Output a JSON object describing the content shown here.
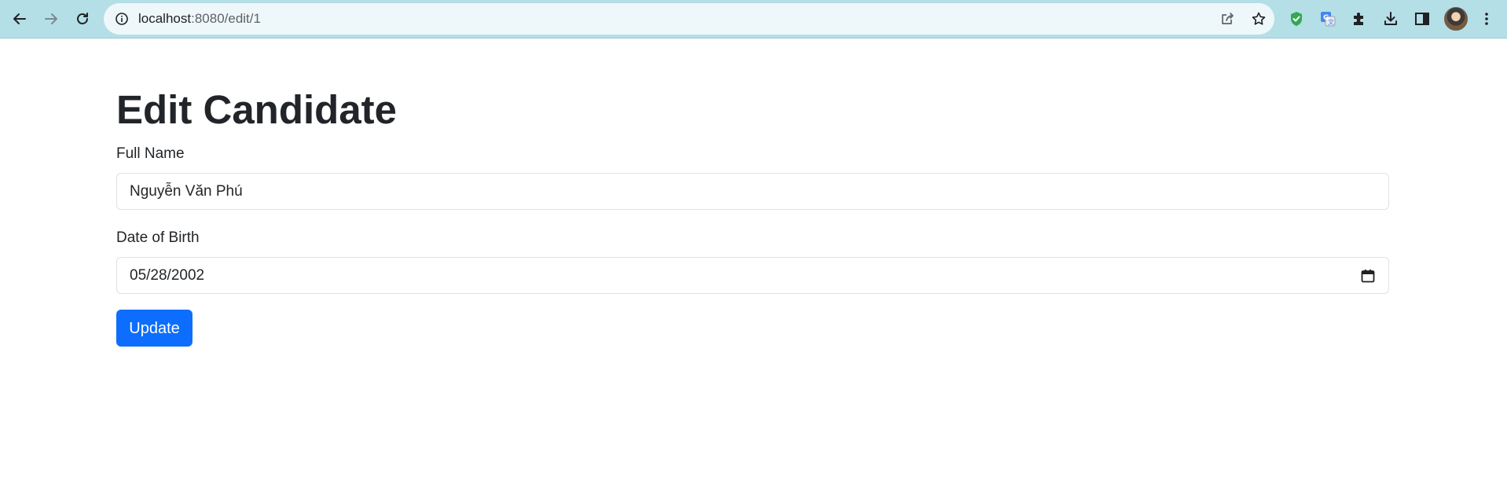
{
  "browser": {
    "url_host": "localhost",
    "url_rest": ":8080/edit/1",
    "icons": {
      "back": "back-arrow-icon",
      "forward": "forward-arrow-icon",
      "reload": "reload-icon",
      "site_info": "info-icon",
      "share": "share-icon",
      "bookmark": "star-icon",
      "extensions": [
        "shield-check-icon",
        "translate-icon",
        "puzzle-icon",
        "download-icon",
        "side-panel-icon"
      ],
      "menu": "kebab-menu-icon"
    },
    "colors": {
      "toolbar": "#b4dfe6",
      "omnibox": "#eef7f9"
    }
  },
  "page": {
    "title": "Edit Candidate",
    "full_name_label": "Full Name",
    "full_name_value": "Nguyễn Văn Phú",
    "dob_label": "Date of Birth",
    "dob_value": "05/28/2002",
    "submit_label": "Update",
    "colors": {
      "primary": "#0d6efd",
      "text": "#212529",
      "border": "#dee2e6"
    }
  }
}
